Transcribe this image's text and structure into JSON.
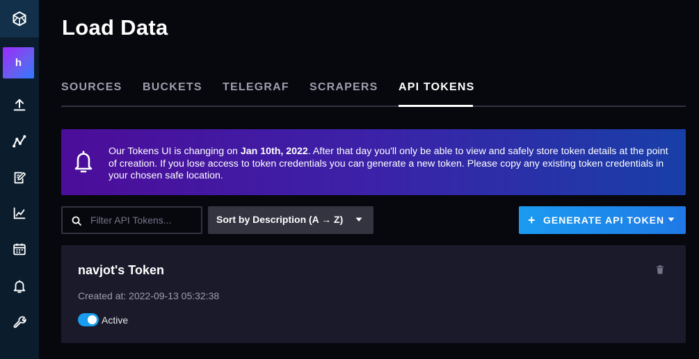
{
  "sidebar": {
    "logo_icon": "influxdb-cube-icon",
    "avatar_letter": "h",
    "items": [
      {
        "icon": "upload-icon"
      },
      {
        "icon": "graph-nodes-icon"
      },
      {
        "icon": "notebook-edit-icon"
      },
      {
        "icon": "line-chart-icon"
      },
      {
        "icon": "calendar-icon"
      },
      {
        "icon": "bell-icon"
      },
      {
        "icon": "wrench-icon"
      }
    ]
  },
  "page": {
    "title": "Load Data"
  },
  "tabs": [
    {
      "label": "SOURCES",
      "active": false
    },
    {
      "label": "BUCKETS",
      "active": false
    },
    {
      "label": "TELEGRAF",
      "active": false
    },
    {
      "label": "SCRAPERS",
      "active": false
    },
    {
      "label": "API TOKENS",
      "active": true
    }
  ],
  "banner": {
    "icon": "bell-icon",
    "text_before": "Our Tokens UI is changing on ",
    "date": "Jan 10th, 2022",
    "text_after": ". After that day you'll only be able to view and safely store token details at the point of creation. If you lose access to token credentials you can generate a new token. Please copy any existing token credentials in your chosen safe location."
  },
  "filter": {
    "placeholder": "Filter API Tokens...",
    "value": "",
    "icon": "search-icon"
  },
  "sort": {
    "label": "Sort by Description (A → Z)",
    "icon": "caret-down-icon"
  },
  "generate": {
    "plus": "+",
    "label": "GENERATE API TOKEN",
    "icon": "caret-down-icon"
  },
  "tokens": [
    {
      "name": "navjot's Token",
      "created": "Created at: 2022-09-13 05:32:38",
      "status": "Active",
      "enabled": true
    }
  ],
  "colors": {
    "accent_blue": "#1a9df0",
    "banner_purple": "#4c0d9a",
    "banner_blue": "#183fa8",
    "sidebar_bg": "#0b1d2d",
    "card_bg": "#1a1a2a"
  }
}
